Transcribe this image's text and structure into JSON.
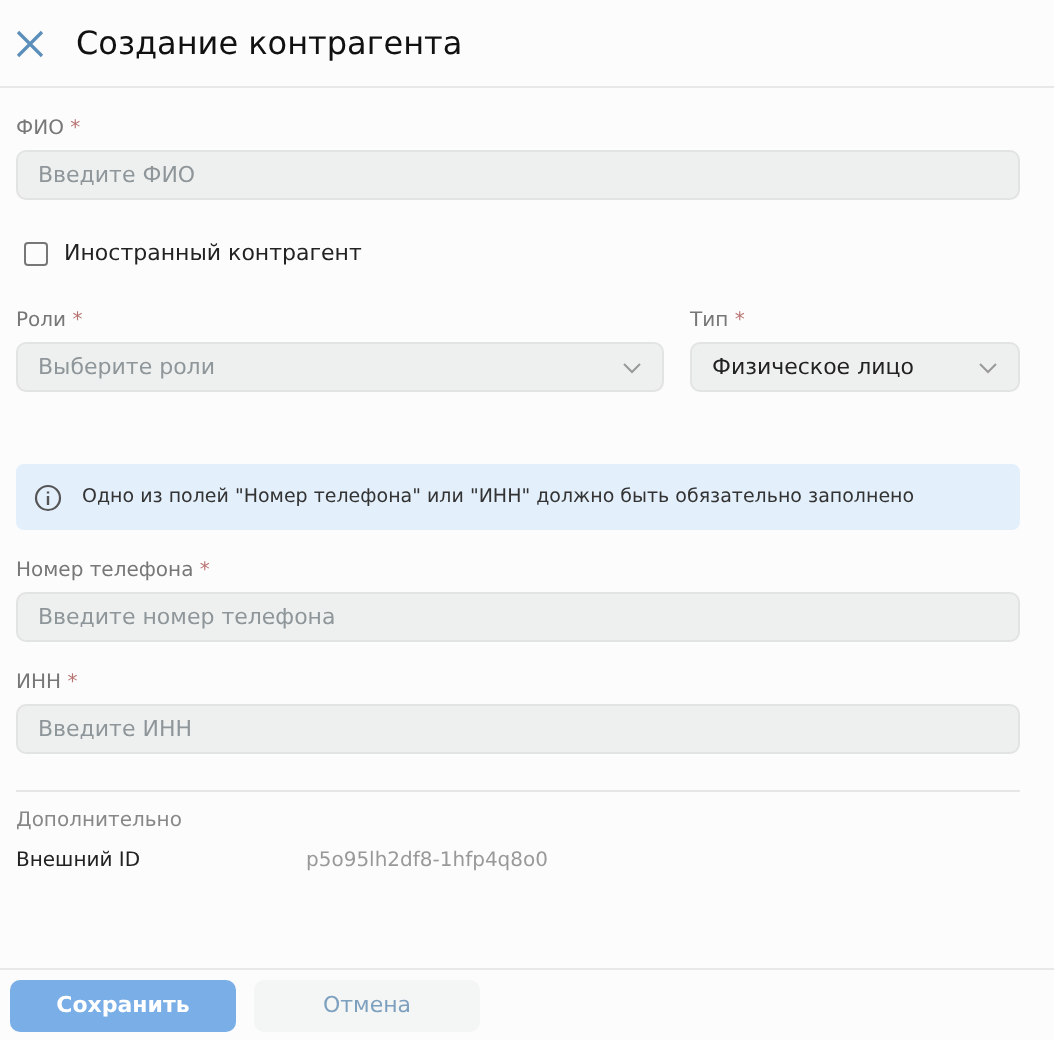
{
  "window": {
    "title": "Создание контрагента"
  },
  "form": [
    {
      "kind": "field",
      "label": "ФИО",
      "mark": "*",
      "dropdown": false,
      "placeholder": "Введите ФИО"
    },
    {
      "kind": "checkbox",
      "label": "Иностранный контрагент",
      "checked": false
    },
    {
      "kind": "row",
      "fields": [
        {
          "label": "Роли",
          "mark": "*",
          "dropdown": true,
          "placeholder": "Выберите роли"
        },
        {
          "label": "Тип",
          "mark": "*",
          "dropdown": true,
          "value": "Физическое лицо"
        }
      ]
    },
    {
      "kind": "info",
      "text": "Одно из полей \"Номер телефона\" или \"ИНН\" должно быть обязательно заполнено"
    },
    {
      "kind": "field",
      "label": "Номер телефона",
      "mark": "*",
      "dropdown": false,
      "placeholder": "Введите номер телефона"
    },
    {
      "kind": "field",
      "label": "ИНН",
      "mark": "*",
      "dropdown": false,
      "placeholder": "Введите ИНН"
    }
  ],
  "extra": {
    "title": "Дополнительно",
    "rows": [
      {
        "label": "Внешний ID",
        "value": "p5o95lh2df8-1hfp4q8o0"
      }
    ]
  },
  "buttons": [
    {
      "label": "Сохранить",
      "kind": "primary"
    },
    {
      "label": "Отмена",
      "kind": "secondary"
    }
  ]
}
